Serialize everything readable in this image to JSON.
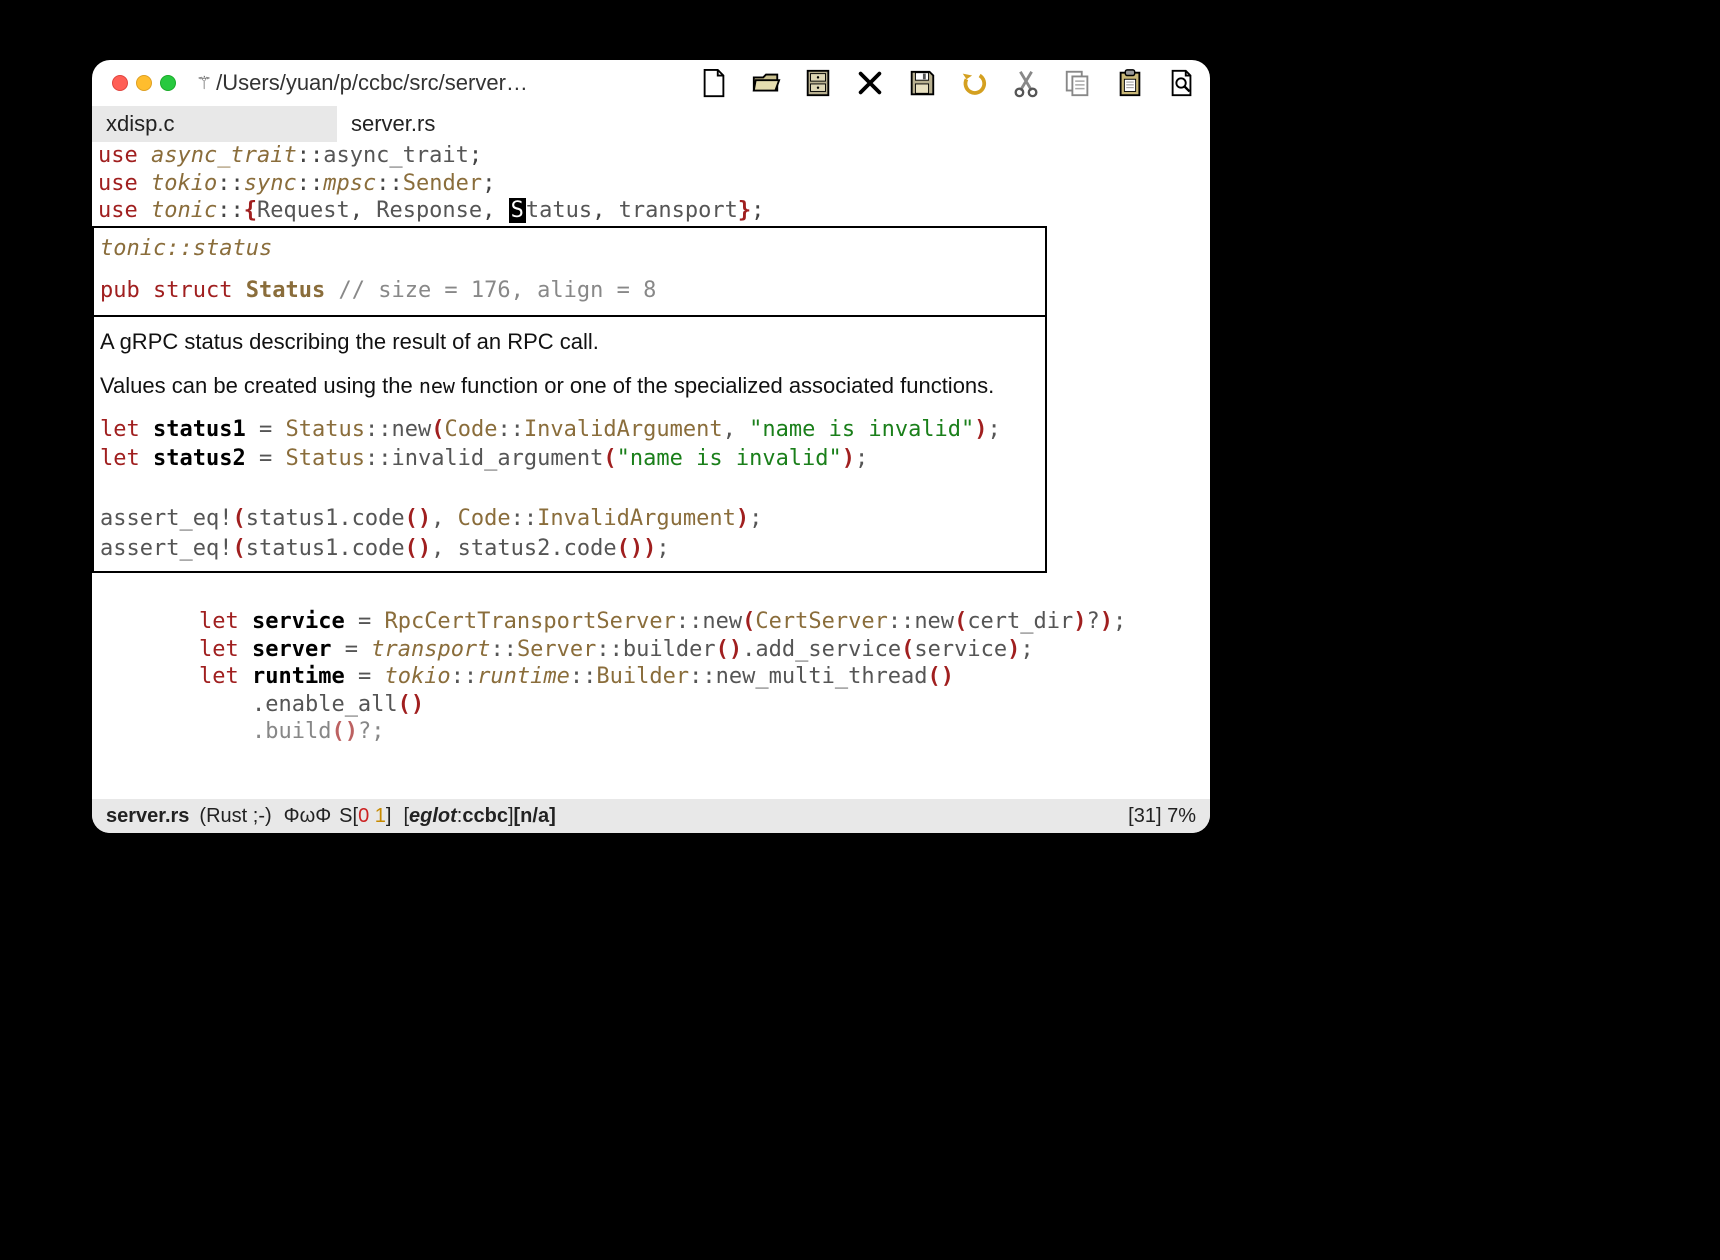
{
  "window": {
    "vcs_symbol": "⚚",
    "path": "/Users/yuan/p/ccbc/src/server…"
  },
  "tabs": {
    "inactive": "xdisp.c",
    "active": "server.rs"
  },
  "code": {
    "line1_use": "use",
    "line1_ns": "async_trait",
    "line1_sep": "::",
    "line1_item": "async_trait",
    "line1_end": ";",
    "line2_use": "use",
    "line2_ns1": "tokio",
    "line2_ns2": "sync",
    "line2_ns3": "mpsc",
    "line2_item": "Sender",
    "line2_end": ";",
    "line3_use": "use",
    "line3_ns": "tonic",
    "line3_brace_open": "{",
    "line3_a": "Request",
    "line3_b": "Response",
    "line3_c_cursor": "S",
    "line3_c_rest": "tatus",
    "line3_d": "transport",
    "line3_brace_close": "}",
    "line3_end": ";"
  },
  "tooltip": {
    "header": "tonic::status",
    "sig_pub": "pub",
    "sig_struct": "struct",
    "sig_name": "Status",
    "sig_comment": "// size = 176, align = 8",
    "doc1": "A gRPC status describing the result of an RPC call.",
    "doc2a": "Values can be created using the ",
    "doc2_code": "new",
    "doc2b": " function or one of the specialized associated functions.",
    "ex1_let": "let",
    "ex1_var": "status1",
    "ex1_eq": " = ",
    "ex1_ty": "Status",
    "ex1_new": "new",
    "ex1_code": "Code",
    "ex1_enum": "InvalidArgument",
    "ex1_str": "\"name is invalid\"",
    "ex2_var": "status2",
    "ex2_fn": "invalid_argument",
    "ex3_macro": "assert_eq!",
    "ex3_a": "status1.code",
    "ex3_code": "Code",
    "ex3_enum": "InvalidArgument",
    "ex4_b": "status2.code"
  },
  "below": {
    "l1_let": "let",
    "l1_var": "service",
    "l1_ty": "RpcCertTransportServer",
    "l1_new": "new",
    "l1_ty2": "CertServer",
    "l1_arg": "cert_dir",
    "l2_var": "server",
    "l2_ns": "transport",
    "l2_ty": "Server",
    "l2_b": "builder",
    "l2_m": "add_service",
    "l2_arg": "service",
    "l3_var": "runtime",
    "l3_ns1": "tokio",
    "l3_ns2": "runtime",
    "l3_ty": "Builder",
    "l3_fn": "new_multi_thread",
    "l4_fn": "enable_all",
    "l5_fn": "build"
  },
  "status": {
    "file": "server.rs",
    "mode": "(Rust ;-)",
    "flycheck_sym": "ΦωΦ",
    "flycheck_s": "S[",
    "flycheck_err": "0",
    "flycheck_warn": " 1",
    "flycheck_close": "]",
    "eglot_open": "[",
    "eglot_label": "eglot",
    "eglot_sep": ":",
    "eglot_proj": "ccbc",
    "eglot_close": "]",
    "na": " [n/a]",
    "pos": "[31] 7%"
  },
  "toolbar": {
    "new": "new-file-icon",
    "open": "open-folder-icon",
    "dired": "dired-icon",
    "close": "close-icon",
    "save": "save-icon",
    "undo": "undo-icon",
    "cut": "cut-icon",
    "copy": "copy-icon",
    "paste": "paste-icon",
    "search": "search-icon"
  }
}
